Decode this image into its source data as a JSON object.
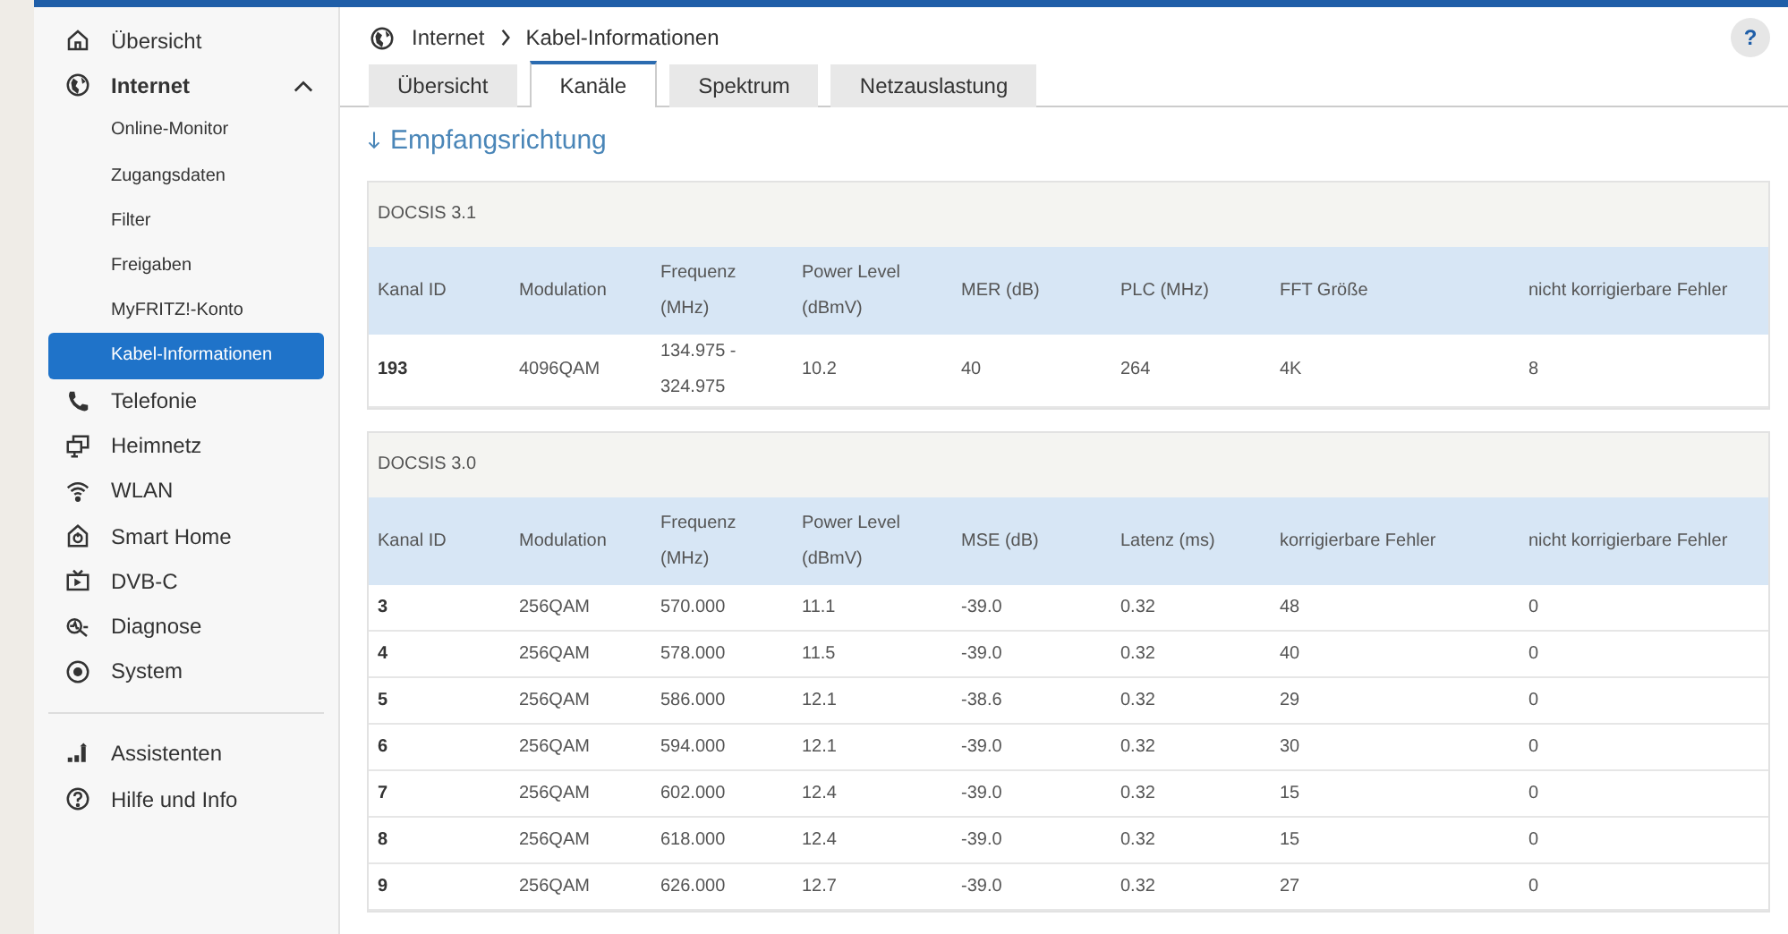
{
  "sidebar": {
    "items": [
      {
        "label": "Übersicht",
        "selected": false
      },
      {
        "label": "Internet",
        "selected": false,
        "expanded": true,
        "children": [
          {
            "label": "Online-Monitor",
            "selected": false
          },
          {
            "label": "Zugangsdaten",
            "selected": false
          },
          {
            "label": "Filter",
            "selected": false
          },
          {
            "label": "Freigaben",
            "selected": false
          },
          {
            "label": "MyFRITZ!-Konto",
            "selected": false
          },
          {
            "label": "Kabel-Informationen",
            "selected": true
          }
        ]
      },
      {
        "label": "Telefonie",
        "selected": false
      },
      {
        "label": "Heimnetz",
        "selected": false
      },
      {
        "label": "WLAN",
        "selected": false
      },
      {
        "label": "Smart Home",
        "selected": false
      },
      {
        "label": "DVB-C",
        "selected": false
      },
      {
        "label": "Diagnose",
        "selected": false
      },
      {
        "label": "System",
        "selected": false
      }
    ],
    "footer_items": [
      {
        "label": "Assistenten",
        "selected": false
      },
      {
        "label": "Hilfe und Info",
        "selected": false
      }
    ]
  },
  "breadcrumb": [
    "Internet",
    "Kabel-Informationen"
  ],
  "help_button": "?",
  "tabs": [
    {
      "label": "Übersicht",
      "selected": false
    },
    {
      "label": "Kanäle",
      "selected": true
    },
    {
      "label": "Spektrum",
      "selected": false
    },
    {
      "label": "Netzauslastung",
      "selected": false
    }
  ],
  "section_title": "Empfangsrichtung",
  "tables": [
    {
      "title": "DOCSIS 3.1",
      "columns": [
        "Kanal ID",
        "Modulation",
        "Frequenz (MHz)",
        "Power Level (dBmV)",
        "MER (dB)",
        "PLC (MHz)",
        "FFT Größe",
        "nicht korrigierbare Fehler"
      ],
      "rows": [
        [
          "193",
          "4096QAM",
          "134.975 - 324.975",
          "10.2",
          "40",
          "264",
          "4K",
          "8"
        ]
      ]
    },
    {
      "title": "DOCSIS 3.0",
      "columns": [
        "Kanal ID",
        "Modulation",
        "Frequenz (MHz)",
        "Power Level (dBmV)",
        "MSE (dB)",
        "Latenz (ms)",
        "korrigierbare Fehler",
        "nicht korrigierbare Fehler"
      ],
      "rows": [
        [
          "3",
          "256QAM",
          "570.000",
          "11.1",
          "-39.0",
          "0.32",
          "48",
          "0"
        ],
        [
          "4",
          "256QAM",
          "578.000",
          "11.5",
          "-39.0",
          "0.32",
          "40",
          "0"
        ],
        [
          "5",
          "256QAM",
          "586.000",
          "12.1",
          "-38.6",
          "0.32",
          "29",
          "0"
        ],
        [
          "6",
          "256QAM",
          "594.000",
          "12.1",
          "-39.0",
          "0.32",
          "30",
          "0"
        ],
        [
          "7",
          "256QAM",
          "602.000",
          "12.4",
          "-39.0",
          "0.32",
          "15",
          "0"
        ],
        [
          "8",
          "256QAM",
          "618.000",
          "12.4",
          "-39.0",
          "0.32",
          "15",
          "0"
        ],
        [
          "9",
          "256QAM",
          "626.000",
          "12.7",
          "-39.0",
          "0.32",
          "27",
          "0"
        ]
      ]
    }
  ]
}
